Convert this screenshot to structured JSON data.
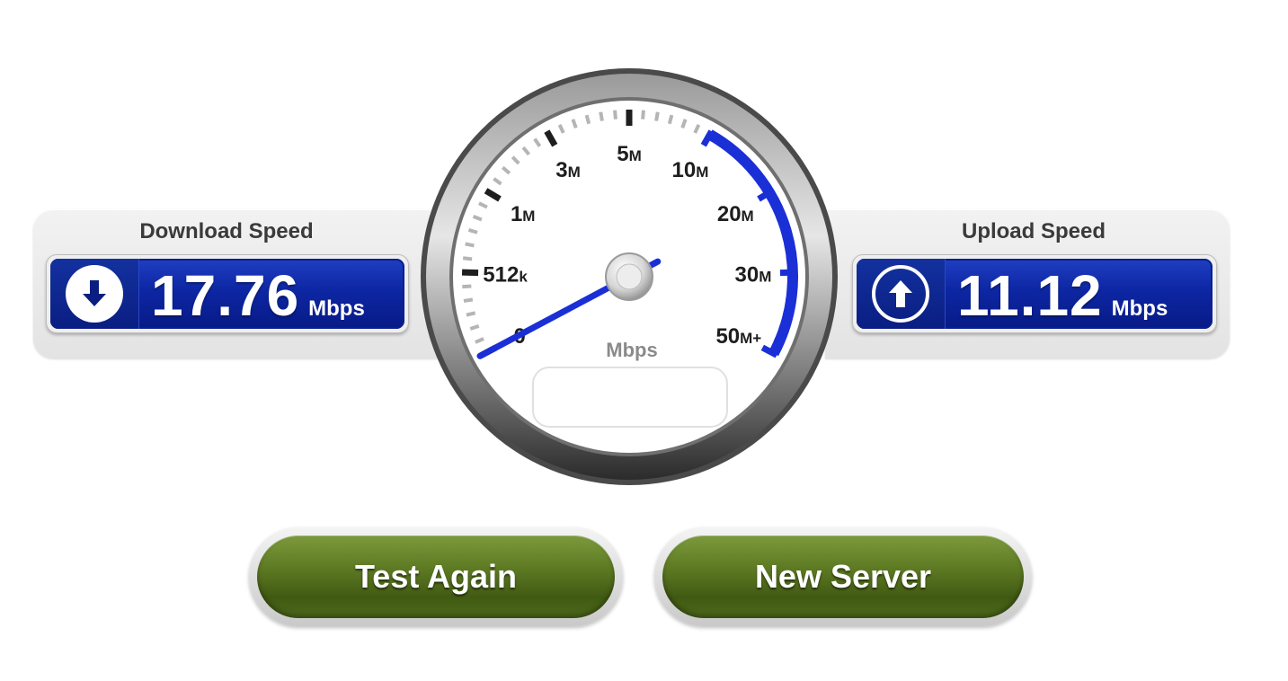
{
  "download": {
    "title": "Download Speed",
    "value": "17.76",
    "unit": "Mbps",
    "icon": "download-arrow-icon"
  },
  "upload": {
    "title": "Upload Speed",
    "value": "11.12",
    "unit": "Mbps",
    "icon": "upload-arrow-icon"
  },
  "gauge": {
    "unit_label": "Mbps",
    "scale_labels": [
      {
        "num": "0",
        "suffix": ""
      },
      {
        "num": "512",
        "suffix": "k"
      },
      {
        "num": "1",
        "suffix": "M"
      },
      {
        "num": "3",
        "suffix": "M"
      },
      {
        "num": "5",
        "suffix": "M"
      },
      {
        "num": "10",
        "suffix": "M"
      },
      {
        "num": "20",
        "suffix": "M"
      },
      {
        "num": "30",
        "suffix": "M"
      },
      {
        "num": "50",
        "suffix": "M+"
      }
    ],
    "needle_value_mbps": 0,
    "display_text": ""
  },
  "buttons": {
    "test_again": "Test Again",
    "new_server": "New Server"
  },
  "colors": {
    "readout_blue": "#0d26a3",
    "gauge_arc_blue": "#1a2fd6",
    "button_green": "#5d7a23"
  }
}
